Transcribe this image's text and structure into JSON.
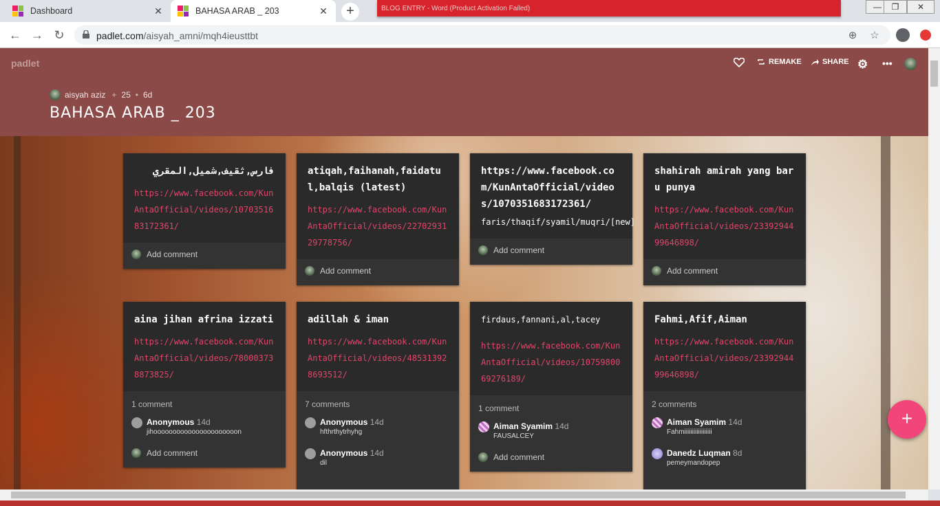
{
  "browser": {
    "tabs": [
      {
        "title": "Dashboard"
      },
      {
        "title": "BAHASA ARAB _ 203"
      }
    ],
    "url_host": "padlet.com",
    "url_path": "/aisyah_amni/mqh4ieusttbt",
    "bg_window_text": "BLOG ENTRY  -  Word (Product Activation Failed)"
  },
  "padlet": {
    "logo": "padlet",
    "header": {
      "remake": "REMAKE",
      "share": "SHARE"
    },
    "author": "aisyah aziz",
    "likes": "25",
    "age": "6d",
    "title": "BAHASA ARAB _ 203",
    "colors": {
      "header": "#8b4a47",
      "card": "#2a2a2a",
      "link": "#e0456b",
      "fab": "#f2457a"
    }
  },
  "cards": [
    {
      "title": "فارس,ثقيف,شميل,المقري",
      "link": "https://www.facebook.com/KunAntaOfficial/videos/1070351683172361/",
      "add": "Add comment"
    },
    {
      "title": "atiqah,faihanah,faidatul,balqis (latest)",
      "link": "https://www.facebook.com/KunAntaOfficial/videos/2270293129778756/",
      "add": "Add comment"
    },
    {
      "title": "https://www.facebook.com/KunAntaOfficial/videos/1070351683172361/",
      "text": "faris/thaqif/syamil/muqri/[new]",
      "add": "Add comment"
    },
    {
      "title": "shahirah amirah yang baru punya",
      "link": "https://www.facebook.com/KunAntaOfficial/videos/2339294499646898/",
      "add": "Add comment"
    },
    {
      "title": "aina jihan afrina izzati",
      "link": "https://www.facebook.com/KunAntaOfficial/videos/780003738873825/",
      "count": "1 comment",
      "comments": [
        {
          "name": "Anonymous",
          "time": "14d",
          "text": "jihoooooooooooooooooooooon"
        }
      ],
      "add": "Add comment"
    },
    {
      "title": "adillah & iman",
      "link": "https://www.facebook.com/KunAntaOfficial/videos/485313928693512/",
      "count": "7 comments",
      "comments": [
        {
          "name": "Anonymous",
          "time": "14d",
          "text": "hfthrthytrhyhg"
        },
        {
          "name": "Anonymous",
          "time": "14d",
          "text": "dil"
        }
      ]
    },
    {
      "text": "firdaus,fannani,al,tacey",
      "link": "https://www.facebook.com/KunAntaOfficial/videos/1075980069276189/",
      "count": "1 comment",
      "comments": [
        {
          "name": "Aiman Syamim",
          "time": "14d",
          "text": "FAUSALCEY"
        }
      ],
      "add": "Add comment"
    },
    {
      "title": "Fahmi,Afif,Aiman",
      "link": "https://www.facebook.com/KunAntaOfficial/videos/2339294499646898/",
      "count": "2 comments",
      "comments": [
        {
          "name": "Aiman Syamim",
          "time": "14d",
          "text": "Fahmiiiiiiiiiiiiiiiiii"
        },
        {
          "name": "Danedz Luqman",
          "time": "8d",
          "text": "pemeymandopep"
        }
      ]
    }
  ]
}
